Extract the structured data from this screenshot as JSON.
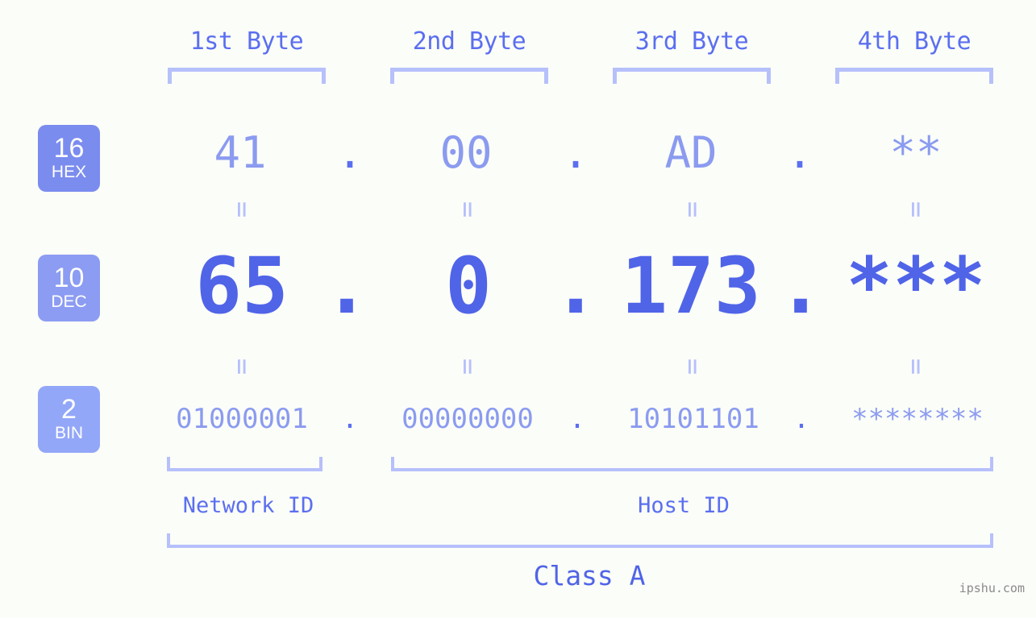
{
  "page": {
    "background_color": "#fbfdf8",
    "accent_color": "#5064e8",
    "accent_light_color": "#8b9bf0",
    "bracket_color": "#b6c0fb",
    "watermark": "ipshu.com"
  },
  "byte_headers": [
    {
      "label": "1st Byte"
    },
    {
      "label": "2nd Byte"
    },
    {
      "label": "3rd Byte"
    },
    {
      "label": "4th Byte"
    }
  ],
  "bases": [
    {
      "number": "16",
      "abbr": "HEX",
      "color": "#7b8cef"
    },
    {
      "number": "10",
      "abbr": "DEC",
      "color": "#8c9cf2"
    },
    {
      "number": "2",
      "abbr": "BIN",
      "color": "#93a7f8"
    }
  ],
  "rows": {
    "hex": {
      "base_number": "16",
      "base_abbr": "HEX",
      "octets": [
        "41",
        "00",
        "AD",
        "**"
      ],
      "separators": [
        ".",
        ".",
        "."
      ]
    },
    "dec": {
      "base_number": "10",
      "base_abbr": "DEC",
      "octets": [
        "65",
        "0",
        "173",
        "***"
      ],
      "separators": [
        ".",
        ".",
        "."
      ]
    },
    "bin": {
      "base_number": "2",
      "base_abbr": "BIN",
      "octets": [
        "01000001",
        "00000000",
        "10101101",
        "********"
      ],
      "separators": [
        ".",
        ".",
        "."
      ]
    }
  },
  "connectors": {
    "glyph": "=",
    "count_per_row": 4
  },
  "segments": {
    "network_id": "Network ID",
    "host_id": "Host ID",
    "class": "Class A"
  }
}
